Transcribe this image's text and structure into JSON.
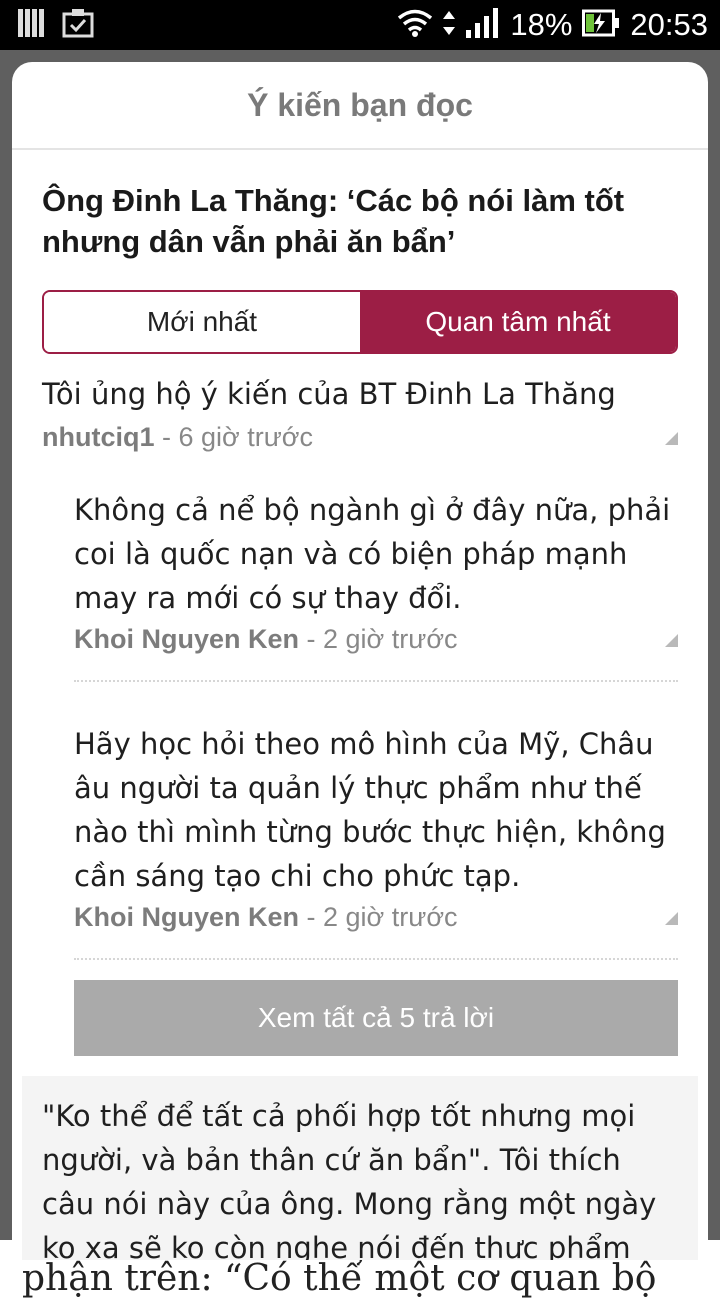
{
  "status_bar": {
    "battery": "18%",
    "time": "20:53",
    "icons": [
      "notification-bars-icon",
      "clipboard-check-icon",
      "wifi-icon",
      "data-arrows-icon",
      "signal-icon",
      "battery-charging-icon"
    ]
  },
  "background": {
    "article_text": "phận trên: “Có thể một cơ quan bộ"
  },
  "dialog": {
    "title": "Ý kiến bạn đọc",
    "article_title": "Ông Đinh La Thăng: ‘Các bộ nói làm tốt nhưng dân vẫn phải ăn bẩn’",
    "tabs": [
      {
        "label": "Mới nhất",
        "active": false
      },
      {
        "label": "Quan tâm nhất",
        "active": true
      }
    ],
    "accent_color": "#9c1e45"
  },
  "comments": [
    {
      "text": "Tôi ủng hộ ý kiến của BT Đinh La Thăng",
      "author": "nhutciq1",
      "time": " - 6 giờ trước",
      "replies": [
        {
          "text": "Không cả nể bộ ngành gì ở đây nữa, phải coi là quốc nạn và có biện pháp mạnh may ra mới có sự thay đổi.",
          "author": "Khoi Nguyen Ken",
          "time": " - 2 giờ trước"
        },
        {
          "text": "Hãy học hỏi theo mô hình của Mỹ, Châu âu người ta quản lý thực phẩm như thế nào thì mình từng bước thực hiện, không cần sáng tạo chi cho phức tạp.",
          "author": "Khoi Nguyen Ken",
          "time": " - 2 giờ trước"
        }
      ],
      "view_all_label": "Xem tất cả 5 trả lời"
    },
    {
      "text": "\"Ko thể để tất cả phối hợp tốt nhưng mọi người, và bản thân cứ ăn bẩn\". Tôi thích câu nói này của ông. Mong rằng một ngày ko xa sẽ ko còn nghe nói đến thực phẩm bẩn nữa"
    }
  ]
}
